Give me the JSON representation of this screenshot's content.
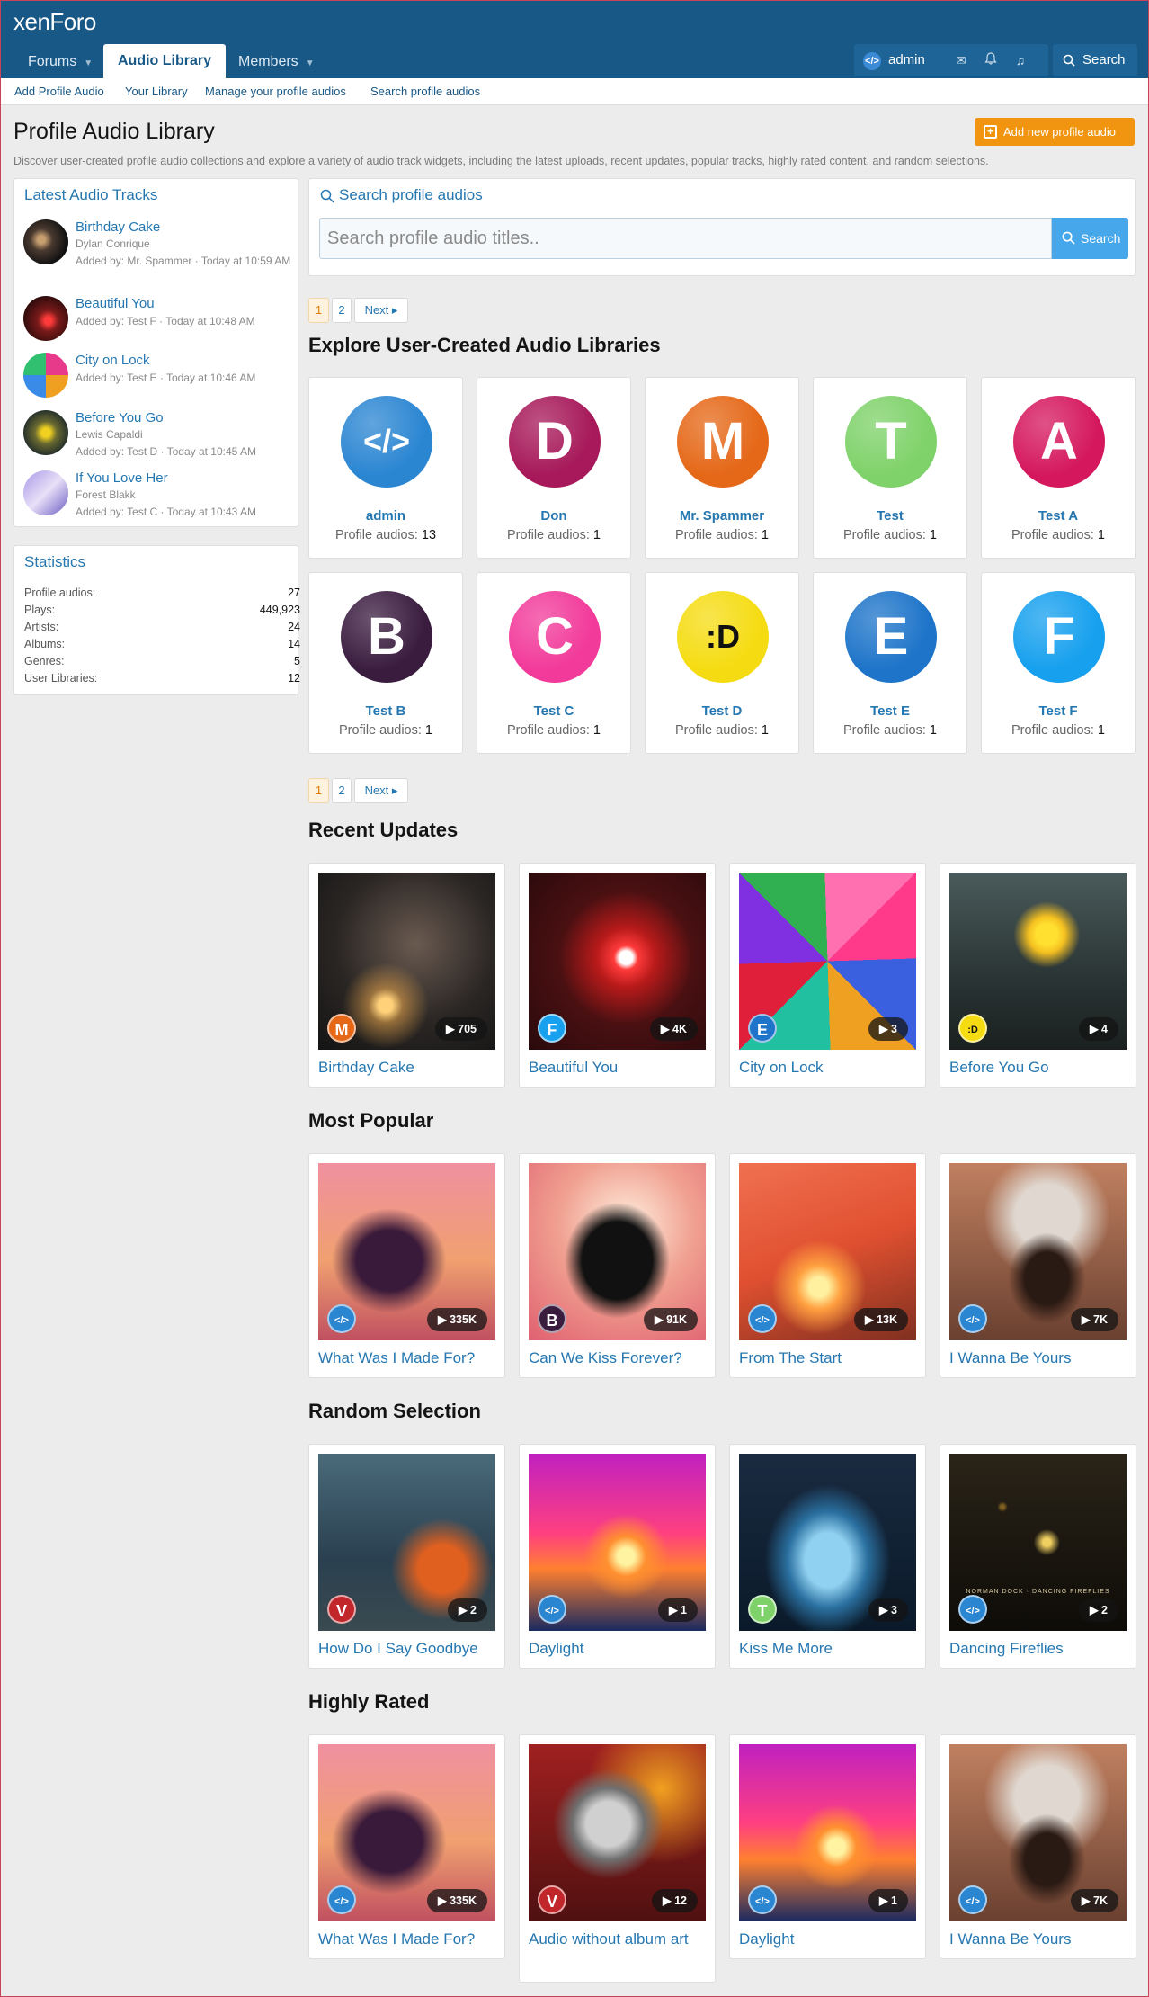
{
  "header": {
    "logo": "xenForo",
    "nav": [
      {
        "label": "Forums"
      },
      {
        "label": "Audio Library"
      },
      {
        "label": "Members"
      }
    ],
    "username": "admin",
    "search_label": "Search"
  },
  "subnav": [
    "Add Profile Audio",
    "Your Library",
    "Manage your profile audios",
    "Search profile audios"
  ],
  "page": {
    "title": "Profile Audio Library",
    "description": "Discover user-created profile audio collections and explore a variety of audio track widgets, including the latest uploads, recent updates, popular tracks, highly rated content, and random selections.",
    "add_button": "Add new profile audio"
  },
  "sidebar": {
    "latest_title": "Latest Audio Tracks",
    "latest": [
      {
        "title": "Birthday Cake",
        "artist": "Dylan Conrique",
        "added": "Added by: Mr. Spammer · Today at 10:59 AM"
      },
      {
        "title": "Beautiful You",
        "artist": "",
        "added": "Added by: Test F · Today at 10:48 AM"
      },
      {
        "title": "City on Lock",
        "artist": "",
        "added": "Added by: Test E · Today at 10:46 AM"
      },
      {
        "title": "Before You Go",
        "artist": "Lewis Capaldi",
        "added": "Added by: Test D · Today at 10:45 AM"
      },
      {
        "title": "If You Love Her",
        "artist": "Forest Blakk",
        "added": "Added by: Test C · Today at 10:43 AM"
      }
    ],
    "stats_title": "Statistics",
    "stats": [
      {
        "label": "Profile audios:",
        "value": "27"
      },
      {
        "label": "Plays:",
        "value": "449,923"
      },
      {
        "label": "Artists:",
        "value": "24"
      },
      {
        "label": "Albums:",
        "value": "14"
      },
      {
        "label": "Genres:",
        "value": "5"
      },
      {
        "label": "User Libraries:",
        "value": "12"
      }
    ]
  },
  "search": {
    "title": "Search profile audios",
    "placeholder": "Search profile audio titles..",
    "button": "Search"
  },
  "pager": {
    "p1": "1",
    "p2": "2",
    "next": "Next"
  },
  "sections": {
    "explore": "Explore User-Created Audio Libraries",
    "recent": "Recent Updates",
    "popular": "Most Popular",
    "random": "Random Selection",
    "rated": "Highly Rated"
  },
  "profile_audios_label": "Profile audios:",
  "users": [
    {
      "name": "admin",
      "count": "13",
      "letter": "</>",
      "color": "#2b86d2"
    },
    {
      "name": "Don",
      "count": "1",
      "letter": "D",
      "color": "#a7195a"
    },
    {
      "name": "Mr. Spammer",
      "count": "1",
      "letter": "M",
      "color": "#e56818"
    },
    {
      "name": "Test",
      "count": "1",
      "letter": "T",
      "color": "#7fd26a"
    },
    {
      "name": "Test A",
      "count": "1",
      "letter": "A",
      "color": "#d5185e"
    },
    {
      "name": "Test B",
      "count": "1",
      "letter": "B",
      "color": "#3a1c3f"
    },
    {
      "name": "Test C",
      "count": "1",
      "letter": "C",
      "color": "#f23a9a"
    },
    {
      "name": "Test D",
      "count": "1",
      "letter": ":D",
      "color": "#f5dc12"
    },
    {
      "name": "Test E",
      "count": "1",
      "letter": "E",
      "color": "#1d74c9"
    },
    {
      "name": "Test F",
      "count": "1",
      "letter": "F",
      "color": "#16a0ee"
    }
  ],
  "recent": [
    {
      "title": "Birthday Cake",
      "plays": "705",
      "badge": "M",
      "badge_color": "#e56818"
    },
    {
      "title": "Beautiful You",
      "plays": "4K",
      "badge": "F",
      "badge_color": "#16a0ee"
    },
    {
      "title": "City on Lock",
      "plays": "3",
      "badge": "E",
      "badge_color": "#1d74c9"
    },
    {
      "title": "Before You Go",
      "plays": "4",
      "badge": ":D",
      "badge_color": "#f5dc12"
    }
  ],
  "popular": [
    {
      "title": "What Was I Made For?",
      "plays": "335K",
      "badge": "</>",
      "badge_color": "#2b86d2"
    },
    {
      "title": "Can We Kiss Forever?",
      "plays": "91K",
      "badge": "B",
      "badge_color": "#3a1c3f"
    },
    {
      "title": "From The Start",
      "plays": "13K",
      "badge": "</>",
      "badge_color": "#2b86d2"
    },
    {
      "title": "I Wanna Be Yours",
      "plays": "7K",
      "badge": "</>",
      "badge_color": "#2b86d2"
    }
  ],
  "random": [
    {
      "title": "How Do I Say Goodbye",
      "plays": "2",
      "badge": "V",
      "badge_color": "#c0262a"
    },
    {
      "title": "Daylight",
      "plays": "1",
      "badge": "</>",
      "badge_color": "#2b86d2"
    },
    {
      "title": "Kiss Me More",
      "plays": "3",
      "badge": "T",
      "badge_color": "#7fd26a"
    },
    {
      "title": "Dancing Fireflies",
      "plays": "2",
      "badge": "</>",
      "badge_color": "#2b86d2"
    }
  ],
  "rated": [
    {
      "title": "What Was I Made For?",
      "plays": "335K",
      "badge": "</>",
      "badge_color": "#2b86d2"
    },
    {
      "title": "Audio without album art",
      "plays": "12",
      "badge": "V",
      "badge_color": "#c0262a"
    },
    {
      "title": "Daylight",
      "plays": "1",
      "badge": "</>",
      "badge_color": "#2b86d2"
    },
    {
      "title": "I Wanna Be Yours",
      "plays": "7K",
      "badge": "</>",
      "badge_color": "#2b86d2"
    }
  ],
  "album_text": "NORMAN DOCK · DANCING FIREFLIES"
}
